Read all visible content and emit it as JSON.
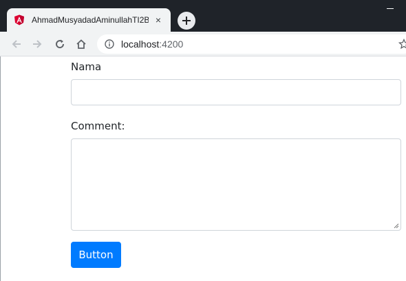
{
  "browser": {
    "tab": {
      "title": "AhmadMusyadadAminullahTI2B",
      "favicon": "angular-icon",
      "close": "×"
    },
    "new_tab": "new-tab-plus-icon",
    "toolbar": {
      "back": "back-arrow-icon",
      "forward": "forward-arrow-icon",
      "reload": "reload-icon",
      "home": "home-icon",
      "url_host": "localhost",
      "url_port": ":4200",
      "bookmark": "star-icon"
    }
  },
  "form": {
    "nama_label": "Nama",
    "nama_value": "",
    "comment_label": "Comment:",
    "comment_value": "",
    "button_label": "Button"
  },
  "colors": {
    "primary": "#007bff",
    "chrome_dark": "#1f2329",
    "chrome_light": "#f1f3f4",
    "angular_red": "#dd0031"
  }
}
